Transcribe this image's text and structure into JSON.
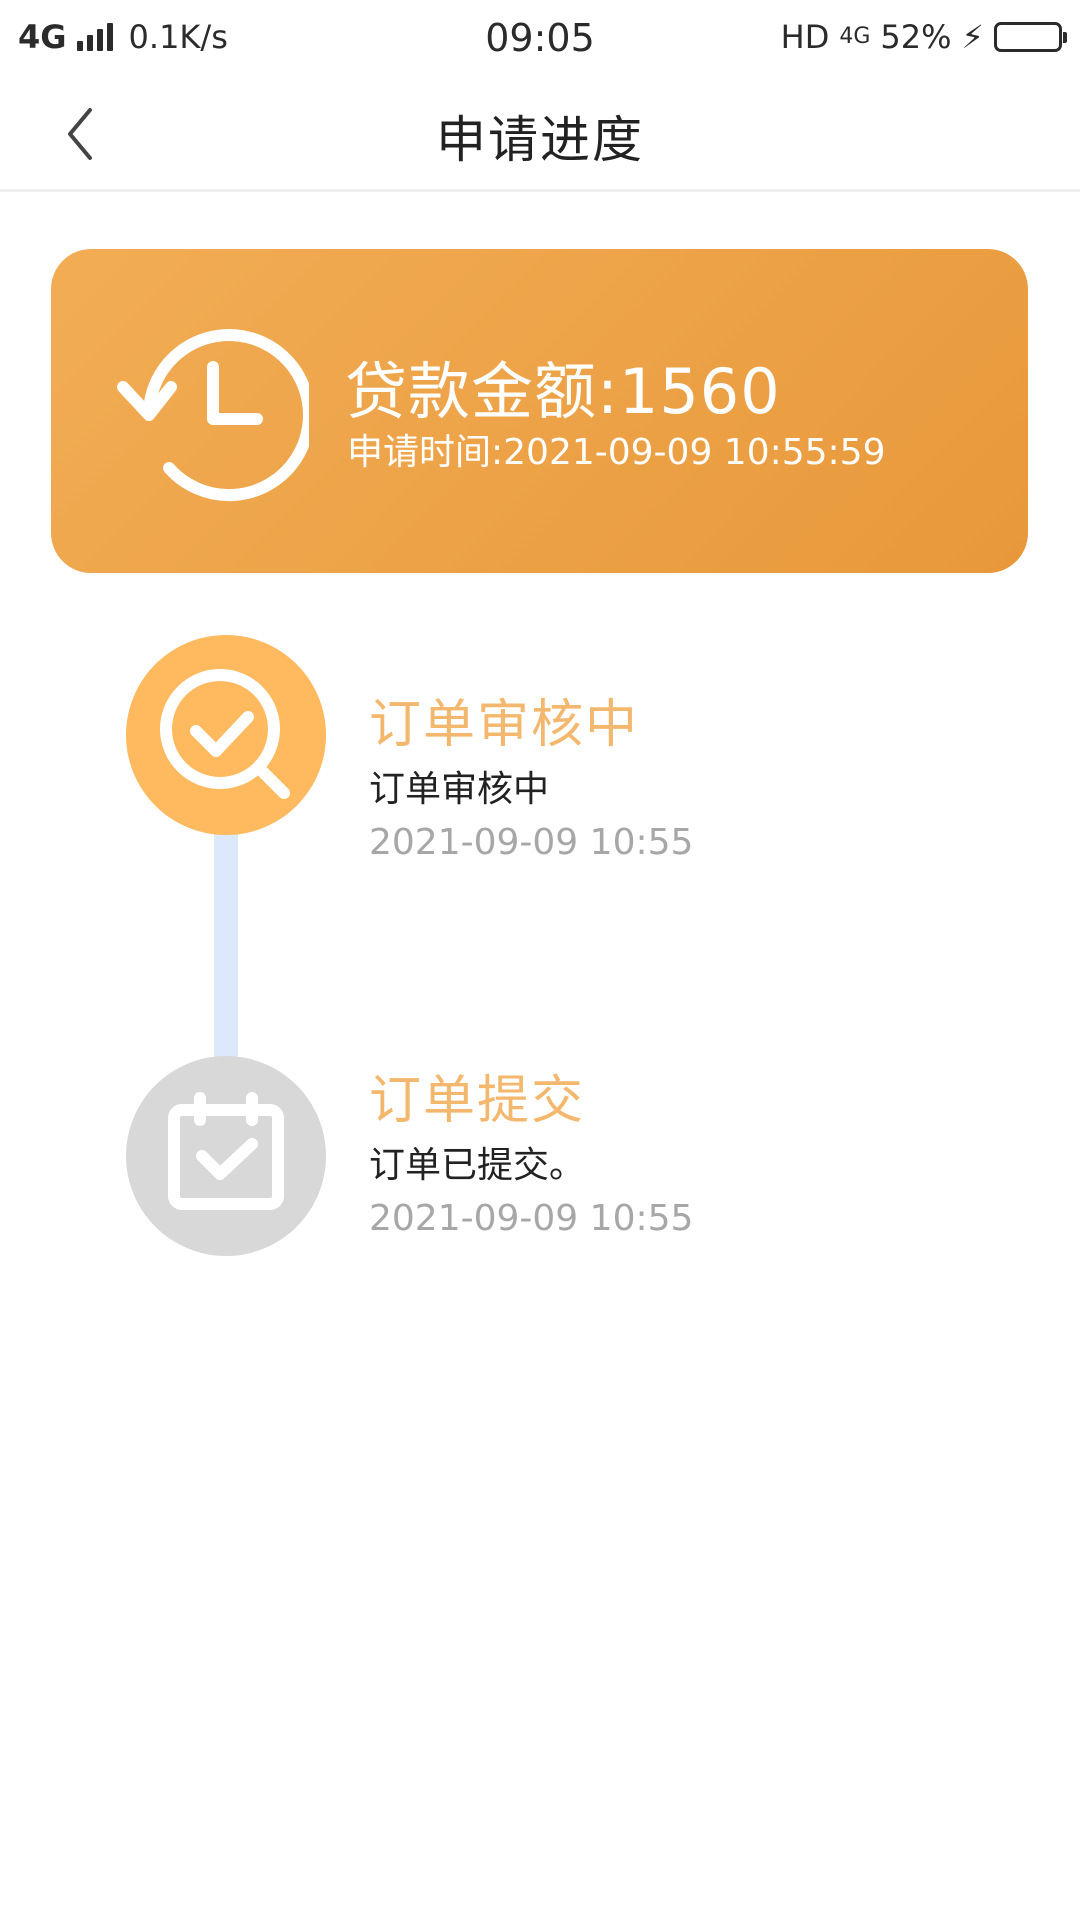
{
  "status_bar": {
    "network": "4G",
    "speed": "0.1K/s",
    "time": "09:05",
    "hd": "HD",
    "network_right": "4G",
    "battery": "52%"
  },
  "nav": {
    "back_icon": "chevron-left-icon",
    "title": "申请进度"
  },
  "summary": {
    "icon": "history-clock-icon",
    "amount": "贷款金额:1560",
    "apply_time": "申请时间:2021-09-09 10:55:59",
    "gradient": [
      "#f2ad55",
      "#e8983a"
    ]
  },
  "timeline": [
    {
      "icon": "search-check-icon",
      "title": "订单审核中",
      "desc": "订单审核中",
      "time": "2021-09-09 10:55",
      "color": "#ffb95f"
    },
    {
      "icon": "calendar-check-icon",
      "title": "订单提交",
      "desc": "订单已提交。",
      "time": "2021-09-09 10:55",
      "color": "#d8d8d8"
    }
  ],
  "colors": {
    "title_accent": "#f3b86d",
    "connector": "#dce8fb"
  }
}
